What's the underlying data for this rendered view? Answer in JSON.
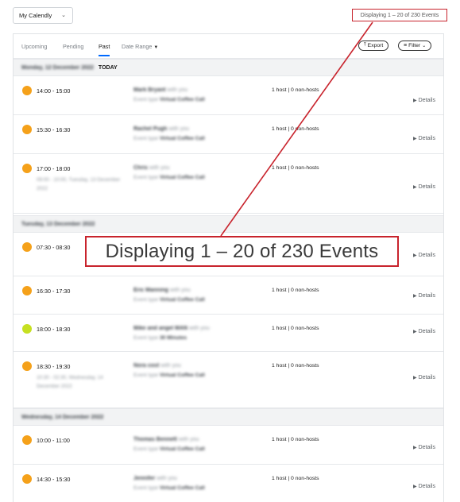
{
  "calendar_select": {
    "label": "My Calendly"
  },
  "counter": {
    "text": "Displaying 1 – 20 of 230 Events"
  },
  "tabs": [
    {
      "label": "Upcoming",
      "active": false
    },
    {
      "label": "Pending",
      "active": false
    },
    {
      "label": "Past",
      "active": true
    },
    {
      "label": "Date Range",
      "active": false
    }
  ],
  "actions": {
    "export_label": "Export",
    "filter_label": "Filter"
  },
  "date_groups": [
    {
      "label": "Monday, 12 December 2022",
      "today_label": "TODAY"
    },
    {
      "label": "Tuesday, 13 December 2022",
      "today_label": ""
    },
    {
      "label": "Wednesday, 14 December 2022",
      "today_label": ""
    }
  ],
  "events": [
    {
      "time": "14:00 - 15:00",
      "subtime": "",
      "name": "Mark Bryant",
      "with": "with you",
      "type_prefix": "Event type",
      "type": "Virtual Coffee Call",
      "hosts": "1 host | 0 non-hosts",
      "details": "Details",
      "color": "#f5a11a"
    },
    {
      "time": "15:30 - 16:30",
      "subtime": "",
      "name": "Rachel Pugh",
      "with": "with you",
      "type_prefix": "Event type",
      "type": "Virtual Coffee Call",
      "hosts": "1 host | 0 non-hosts",
      "details": "Details",
      "color": "#f5a11a"
    },
    {
      "time": "17:00 - 18:00",
      "subtime": "09:00 - 10:00, Tuesday, 13 December 2022",
      "name": "Chris",
      "with": "with you",
      "type_prefix": "Event type",
      "type": "Virtual Coffee Call",
      "hosts": "1 host | 0 non-hosts",
      "details": "Details",
      "color": "#f5a11a"
    },
    {
      "time": "07:30 - 08:30",
      "subtime": "",
      "name": "",
      "with": "",
      "type_prefix": "",
      "type": "",
      "hosts": "",
      "details": "Details",
      "color": "#f5a11a"
    },
    {
      "time": "16:30 - 17:30",
      "subtime": "",
      "name": "Eric Manning",
      "with": "with you",
      "type_prefix": "Event type",
      "type": "Virtual Coffee Call",
      "hosts": "1 host | 0 non-hosts",
      "details": "Details",
      "color": "#f5a11a"
    },
    {
      "time": "18:00 - 18:30",
      "subtime": "",
      "name": "Mike and angel MAN",
      "with": "with you",
      "type_prefix": "Event type",
      "type": "30 Minutes",
      "hosts": "1 host | 0 non-hosts",
      "details": "Details",
      "color": "#c6e021"
    },
    {
      "time": "18:30 - 19:30",
      "subtime": "10:30 - 02:30, Wednesday, 14 December 2022",
      "name": "Nora cost",
      "with": "with you",
      "type_prefix": "Event type",
      "type": "Virtual Coffee Call",
      "hosts": "1 host | 0 non-hosts",
      "details": "Details",
      "color": "#f5a11a"
    },
    {
      "time": "10:00 - 11:00",
      "subtime": "",
      "name": "Thomas Bennett",
      "with": "with you",
      "type_prefix": "Event type",
      "type": "Virtual Coffee Call",
      "hosts": "1 host | 0 non-hosts",
      "details": "Details",
      "color": "#f5a11a"
    },
    {
      "time": "14:30 - 15:30",
      "subtime": "",
      "name": "Jennifer",
      "with": "with you",
      "type_prefix": "Event type",
      "type": "Virtual Coffee Call",
      "hosts": "1 host | 0 non-hosts",
      "details": "Details",
      "color": "#f5a11a"
    }
  ],
  "annotation": {
    "zoom_text": "Displaying 1 – 20 of 230 Events",
    "color": "#c8232c"
  }
}
